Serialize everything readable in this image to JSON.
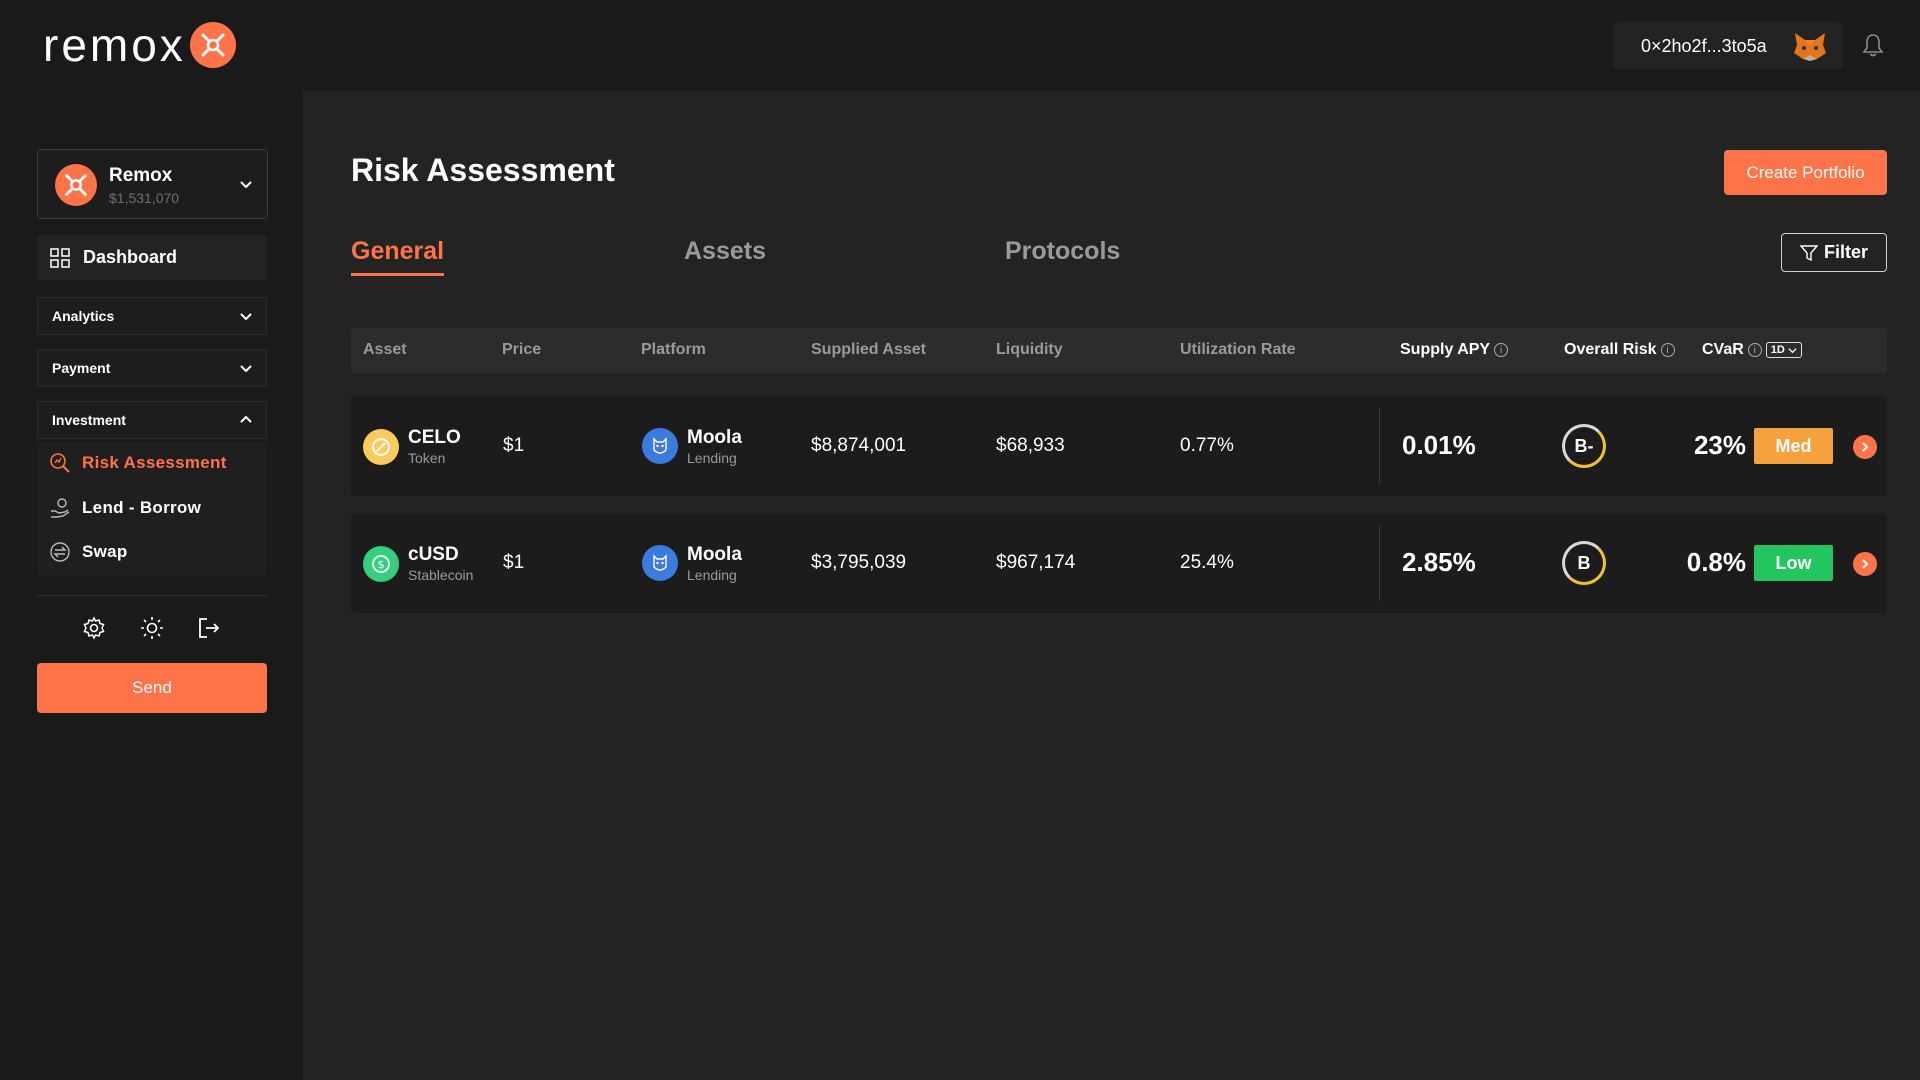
{
  "brand": {
    "name": "remox",
    "accent": "#ff7348"
  },
  "wallet": {
    "address": "0×2ho2f...3to5a"
  },
  "account": {
    "name": "Remox",
    "balance": "$1,531,070"
  },
  "sidebar": {
    "dashboard": "Dashboard",
    "groups": [
      {
        "label": "Analytics",
        "expanded": false
      },
      {
        "label": "Payment",
        "expanded": false
      },
      {
        "label": "Investment",
        "expanded": true
      }
    ],
    "investment_items": [
      {
        "label": "Risk Assessment",
        "active": true
      },
      {
        "label": "Lend - Borrow",
        "active": false
      },
      {
        "label": "Swap",
        "active": false
      }
    ],
    "send_label": "Send"
  },
  "page": {
    "title": "Risk Assessment",
    "create_label": "Create Portfolio",
    "filter_label": "Filter",
    "tabs": [
      {
        "label": "General",
        "active": true
      },
      {
        "label": "Assets",
        "active": false
      },
      {
        "label": "Protocols",
        "active": false
      }
    ]
  },
  "table": {
    "headers": [
      "Asset",
      "Price",
      "Platform",
      "Supplied Asset",
      "Liquidity",
      "Utilization Rate",
      "Supply APY",
      "Overall Risk",
      "CVaR"
    ],
    "cvar_period": "1D",
    "rows": [
      {
        "asset": "CELO",
        "asset_type": "Token",
        "coin_color": "#fbcc5c",
        "price": "$1",
        "platform": "Moola",
        "platform_type": "Lending",
        "supplied": "$8,874,001",
        "liquidity": "$68,933",
        "utilization": "0.77%",
        "apy": "0.01%",
        "grade": "B-",
        "cvar": "23%",
        "risk": "Med",
        "risk_color": "#f5a13d"
      },
      {
        "asset": "cUSD",
        "asset_type": "Stablecoin",
        "coin_color": "#35d07f",
        "price": "$1",
        "platform": "Moola",
        "platform_type": "Lending",
        "supplied": "$3,795,039",
        "liquidity": "$967,174",
        "utilization": "25.4%",
        "apy": "2.85%",
        "grade": "B",
        "cvar": "0.8%",
        "risk": "Low",
        "risk_color": "#22c55e"
      }
    ]
  }
}
